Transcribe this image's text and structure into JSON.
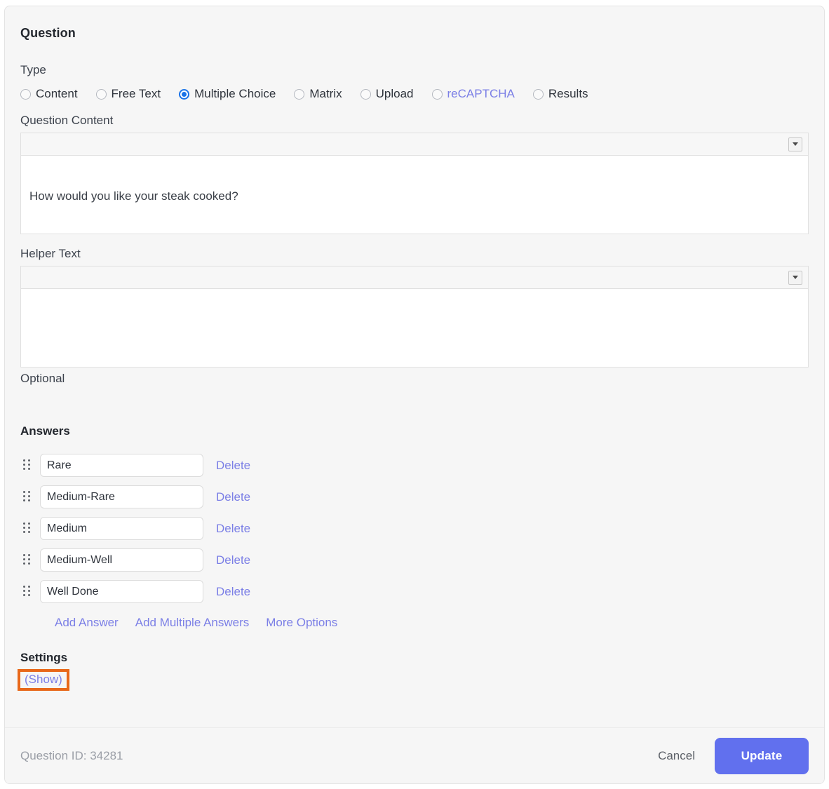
{
  "card": {
    "heading": "Question"
  },
  "type": {
    "label": "Type",
    "options": [
      {
        "label": "Content",
        "selected": false,
        "style": "normal"
      },
      {
        "label": "Free Text",
        "selected": false,
        "style": "normal"
      },
      {
        "label": "Multiple Choice",
        "selected": true,
        "style": "normal"
      },
      {
        "label": "Matrix",
        "selected": false,
        "style": "normal"
      },
      {
        "label": "Upload",
        "selected": false,
        "style": "normal"
      },
      {
        "label": "reCAPTCHA",
        "selected": false,
        "style": "link"
      },
      {
        "label": "Results",
        "selected": false,
        "style": "normal"
      }
    ]
  },
  "question_content": {
    "label": "Question Content",
    "value": "How would you like your steak cooked?",
    "toolbar_dropdown_icon": "chevron-down-icon"
  },
  "helper_text": {
    "label": "Helper Text",
    "value": "",
    "toolbar_dropdown_icon": "chevron-down-icon",
    "note": "Optional"
  },
  "answers": {
    "title": "Answers",
    "delete_label": "Delete",
    "drag_handle_icon": "drag-handle-icon",
    "items": [
      {
        "value": "Rare"
      },
      {
        "value": "Medium-Rare"
      },
      {
        "value": "Medium"
      },
      {
        "value": "Medium-Well"
      },
      {
        "value": "Well Done"
      }
    ],
    "actions": [
      {
        "label": "Add Answer"
      },
      {
        "label": "Add Multiple Answers"
      },
      {
        "label": "More Options"
      }
    ]
  },
  "settings": {
    "title": "Settings",
    "toggle_label": "(Show)",
    "highlight_color": "#e8681a"
  },
  "footer": {
    "question_id_text": "Question ID: 34281",
    "cancel_label": "Cancel",
    "update_label": "Update"
  },
  "colors": {
    "accent": "#6170ee",
    "link": "#7b7fe6",
    "radio_selected": "#1a73e8",
    "card_bg": "#f6f6f6",
    "highlight": "#e8681a"
  }
}
